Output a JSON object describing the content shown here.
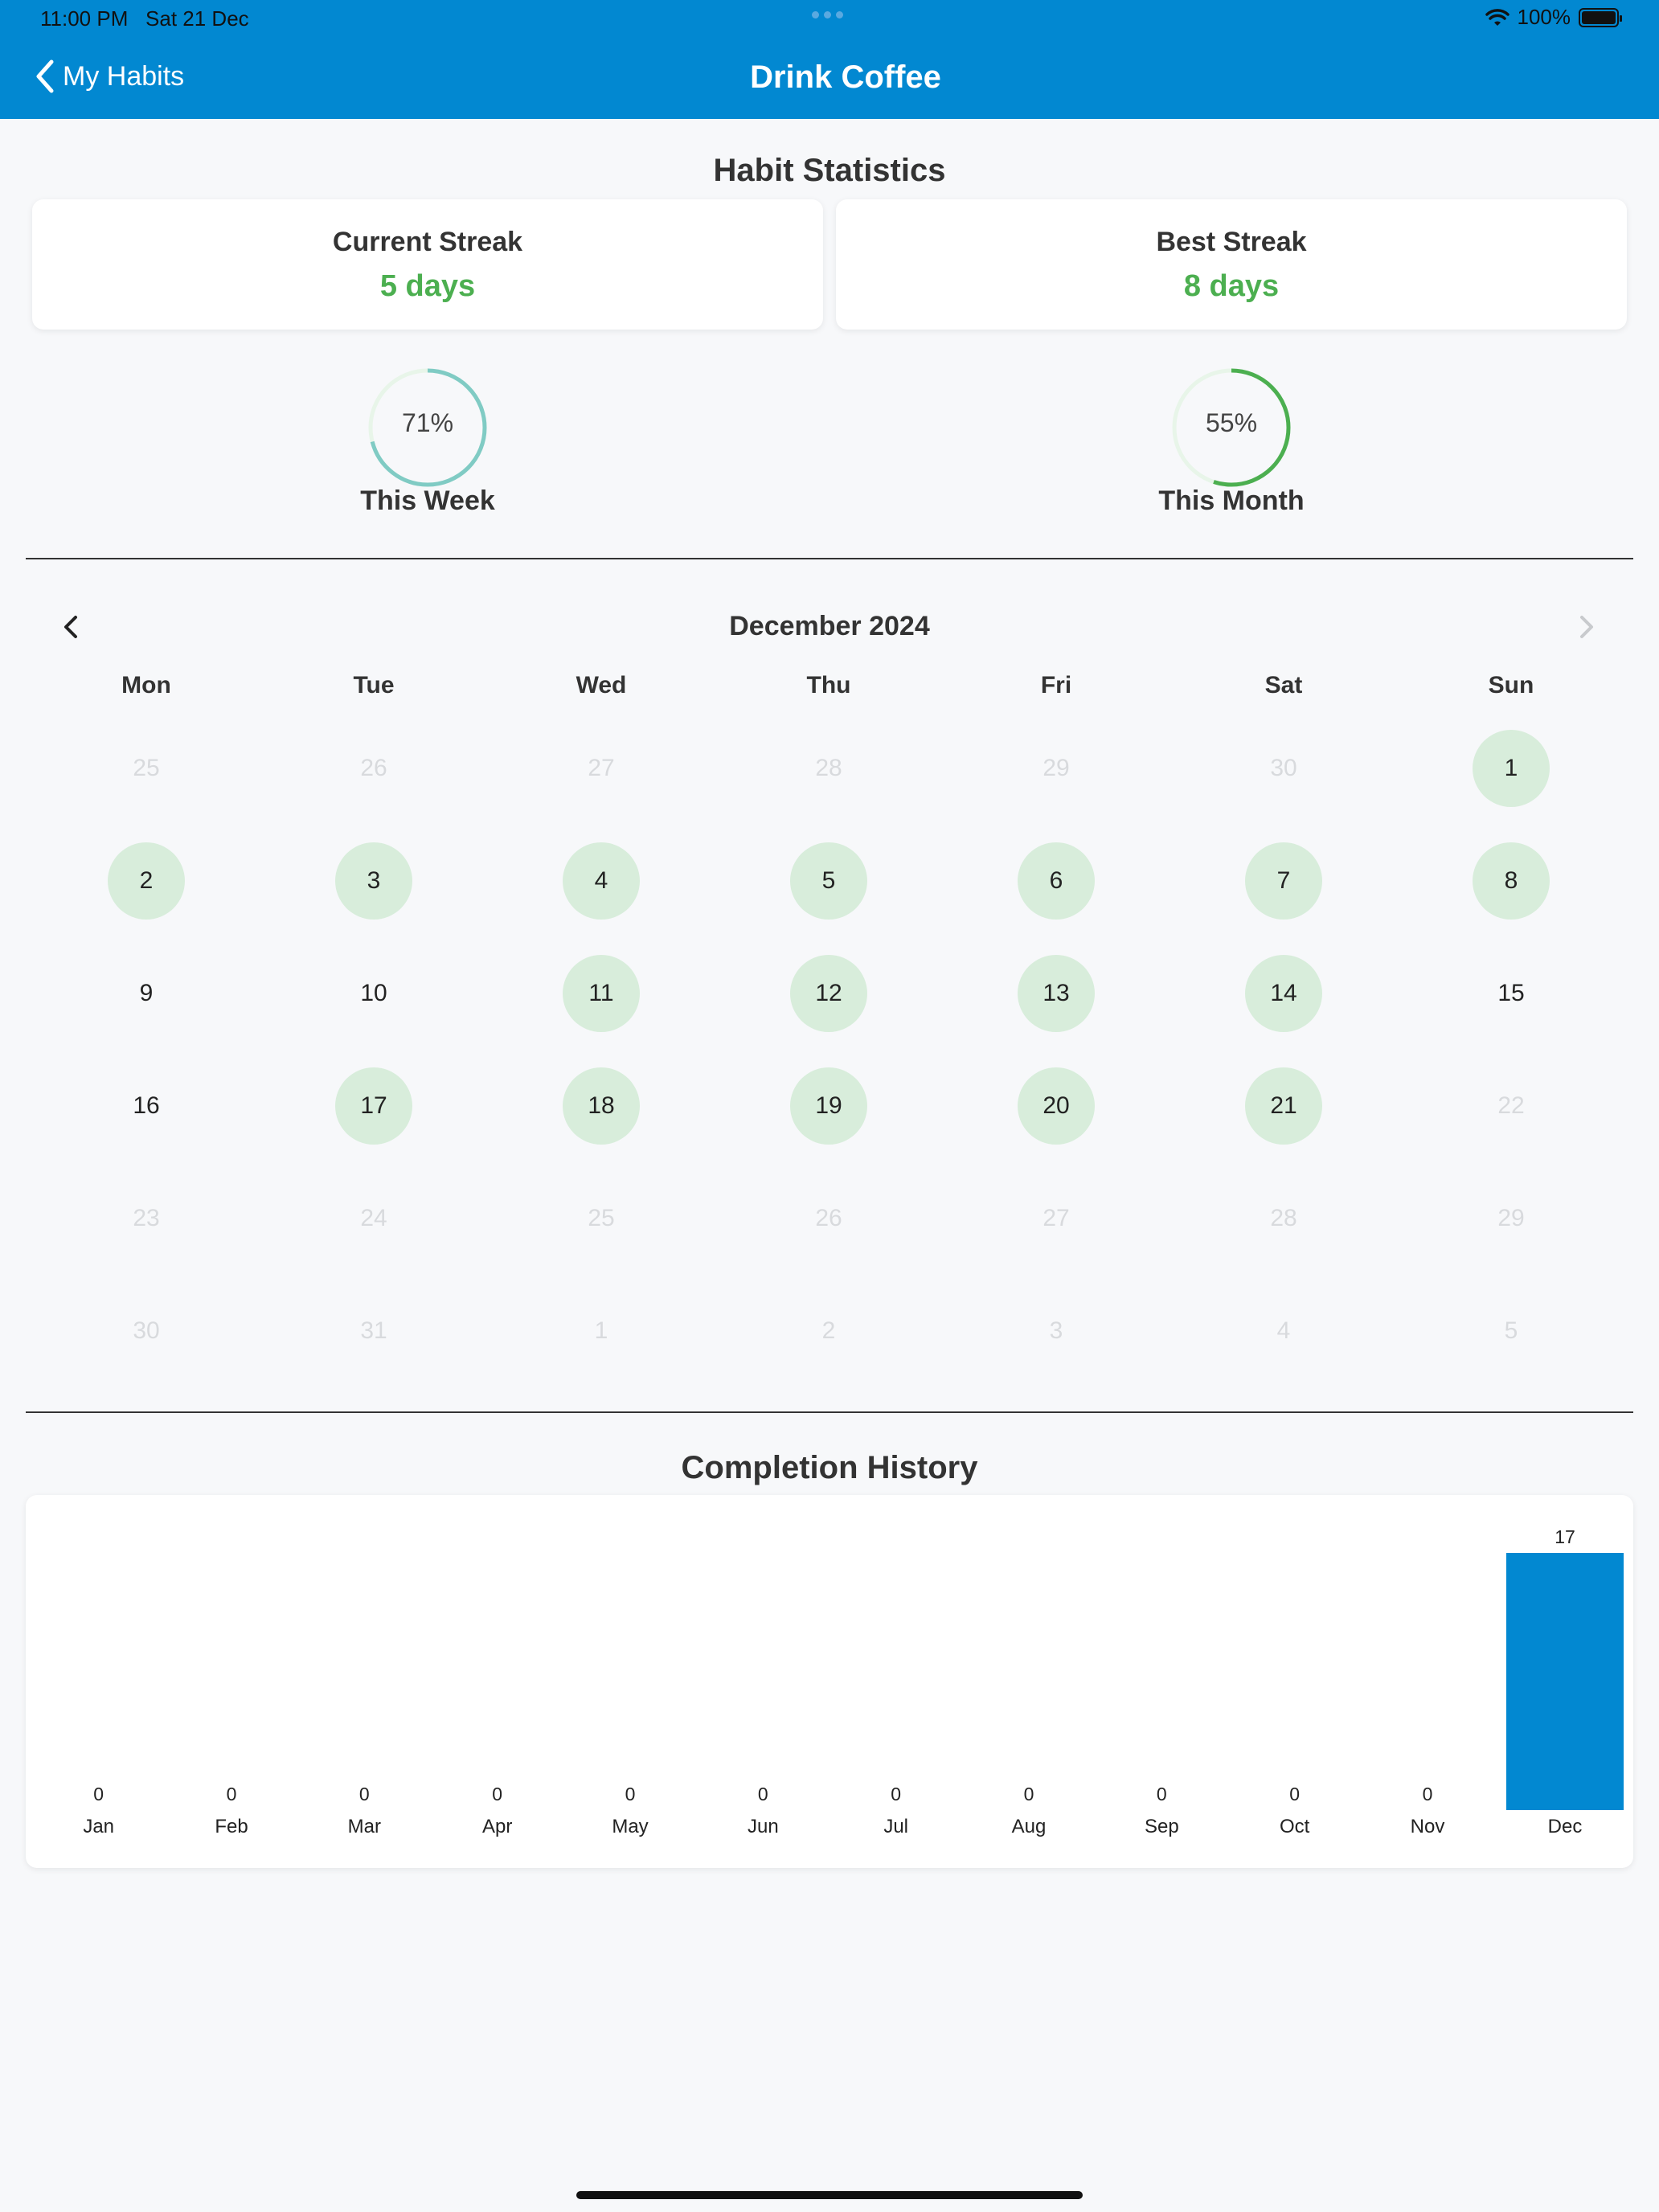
{
  "status_bar": {
    "time": "11:00 PM",
    "date": "Sat 21 Dec",
    "battery": "100%"
  },
  "nav": {
    "back_label": "My Habits",
    "title": "Drink Coffee"
  },
  "stats": {
    "title": "Habit Statistics",
    "current_streak": {
      "label": "Current Streak",
      "value": "5 days"
    },
    "best_streak": {
      "label": "Best Streak",
      "value": "8 days"
    },
    "week": {
      "label": "This Week",
      "percent_text": "71%",
      "percent": 71,
      "color": "#80cbc4"
    },
    "month": {
      "label": "This Month",
      "percent_text": "55%",
      "percent": 55,
      "color": "#4caf50"
    },
    "ring_track_color": "#e8f5e9"
  },
  "calendar": {
    "month_label": "December 2024",
    "weekdays": [
      "Mon",
      "Tue",
      "Wed",
      "Thu",
      "Fri",
      "Sat",
      "Sun"
    ],
    "weeks": [
      [
        {
          "d": "25",
          "s": "out"
        },
        {
          "d": "26",
          "s": "out"
        },
        {
          "d": "27",
          "s": "out"
        },
        {
          "d": "28",
          "s": "out"
        },
        {
          "d": "29",
          "s": "out"
        },
        {
          "d": "30",
          "s": "out"
        },
        {
          "d": "1",
          "s": "done"
        }
      ],
      [
        {
          "d": "2",
          "s": "done"
        },
        {
          "d": "3",
          "s": "done"
        },
        {
          "d": "4",
          "s": "done"
        },
        {
          "d": "5",
          "s": "done"
        },
        {
          "d": "6",
          "s": "done"
        },
        {
          "d": "7",
          "s": "done"
        },
        {
          "d": "8",
          "s": "done"
        }
      ],
      [
        {
          "d": "9",
          "s": "plain"
        },
        {
          "d": "10",
          "s": "plain"
        },
        {
          "d": "11",
          "s": "done"
        },
        {
          "d": "12",
          "s": "done"
        },
        {
          "d": "13",
          "s": "done"
        },
        {
          "d": "14",
          "s": "done"
        },
        {
          "d": "15",
          "s": "plain"
        }
      ],
      [
        {
          "d": "16",
          "s": "plain"
        },
        {
          "d": "17",
          "s": "done"
        },
        {
          "d": "18",
          "s": "done"
        },
        {
          "d": "19",
          "s": "done"
        },
        {
          "d": "20",
          "s": "done"
        },
        {
          "d": "21",
          "s": "done"
        },
        {
          "d": "22",
          "s": "out"
        }
      ],
      [
        {
          "d": "23",
          "s": "out"
        },
        {
          "d": "24",
          "s": "out"
        },
        {
          "d": "25",
          "s": "out"
        },
        {
          "d": "26",
          "s": "out"
        },
        {
          "d": "27",
          "s": "out"
        },
        {
          "d": "28",
          "s": "out"
        },
        {
          "d": "29",
          "s": "out"
        }
      ],
      [
        {
          "d": "30",
          "s": "out"
        },
        {
          "d": "31",
          "s": "out"
        },
        {
          "d": "1",
          "s": "out"
        },
        {
          "d": "2",
          "s": "out"
        },
        {
          "d": "3",
          "s": "out"
        },
        {
          "d": "4",
          "s": "out"
        },
        {
          "d": "5",
          "s": "out"
        }
      ]
    ]
  },
  "history": {
    "title": "Completion History"
  },
  "chart_data": {
    "type": "bar",
    "categories": [
      "Jan",
      "Feb",
      "Mar",
      "Apr",
      "May",
      "Jun",
      "Jul",
      "Aug",
      "Sep",
      "Oct",
      "Nov",
      "Dec"
    ],
    "values": [
      0,
      0,
      0,
      0,
      0,
      0,
      0,
      0,
      0,
      0,
      0,
      17
    ],
    "title": "Completion History",
    "xlabel": "",
    "ylabel": "",
    "ylim": [
      0,
      17
    ],
    "bar_color": "#0288d1",
    "grid": false
  },
  "colors": {
    "accent": "#0288d1",
    "success": "#4caf50",
    "completed_day": "#d8eddb"
  }
}
